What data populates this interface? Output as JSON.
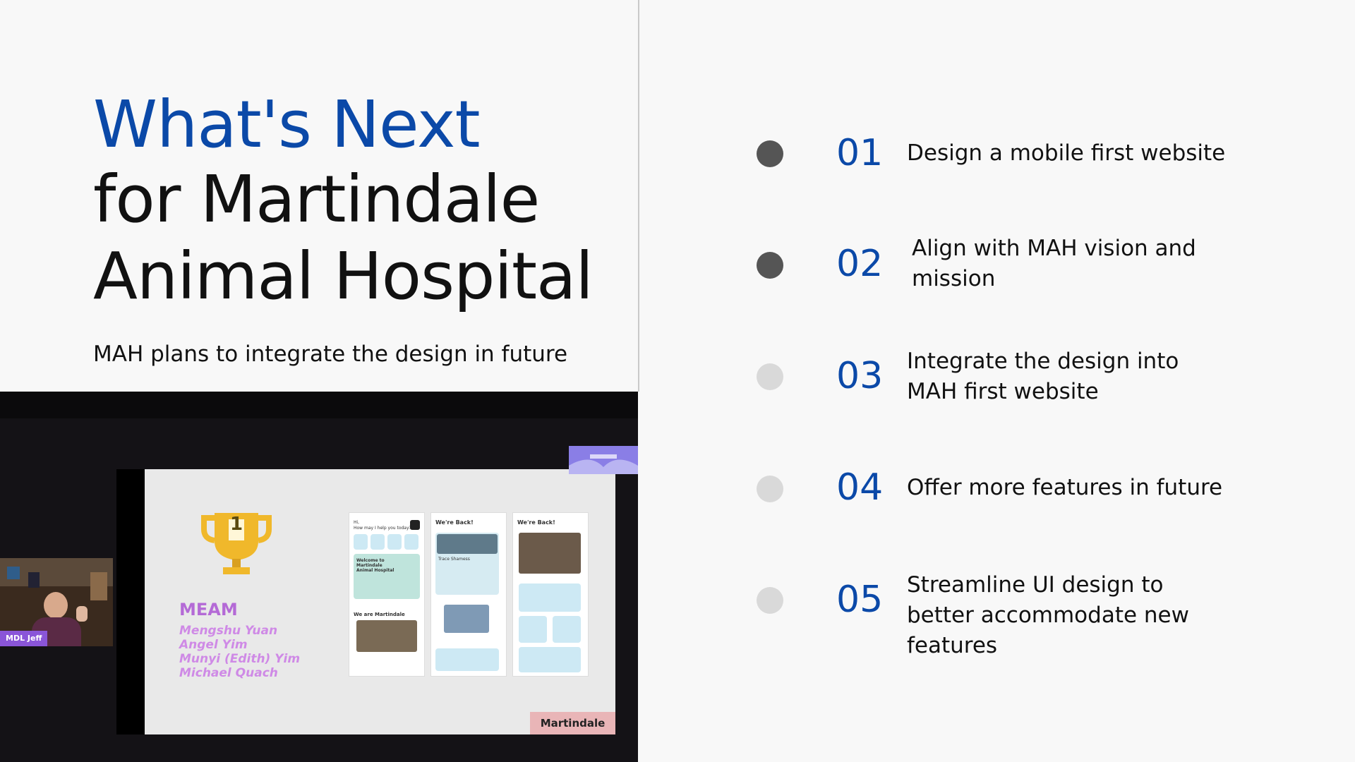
{
  "slide": {
    "title_line1": "What's Next",
    "title_line2": "for Martindale",
    "title_line3": "Animal Hospital",
    "subtitle": "MAH plans to integrate the design in future"
  },
  "items": [
    {
      "number": "01",
      "text": "Design a mobile first website",
      "dot_color": "#555555"
    },
    {
      "number": "02",
      "text": "Align with MAH vision and mission",
      "dot_color": "#555555"
    },
    {
      "number": "03",
      "text": "Integrate the design into MAH first website",
      "dot_color": "#d9d9d9"
    },
    {
      "number": "04",
      "text": "Offer more features in future",
      "dot_color": "#d9d9d9"
    },
    {
      "number": "05",
      "text": "Streamline UI design to better accommodate new features",
      "dot_color": "#d9d9d9"
    }
  ],
  "video": {
    "participant_label": "MDL Jeff",
    "trophy_number": "1",
    "team_name": "MEAM",
    "members": [
      "Mengshu Yuan",
      "Angel Yim",
      "Munyi (Edith) Yim",
      "Michael Quach"
    ],
    "brand": "Martindale",
    "phone1": {
      "greeting": "Hi,",
      "question": "How may I help you today?",
      "welcome": "Welcome to Martindale Animal Hospital",
      "section": "We are Martindale"
    },
    "phone2": {
      "title": "We're Back!",
      "card_name": "Trace Shamess"
    },
    "phone3": {
      "title": "We're Back!"
    }
  },
  "colors": {
    "accent_blue": "#0b49a8",
    "team_purple": "#b46ad6",
    "brand_pink": "#e9b5b7"
  }
}
